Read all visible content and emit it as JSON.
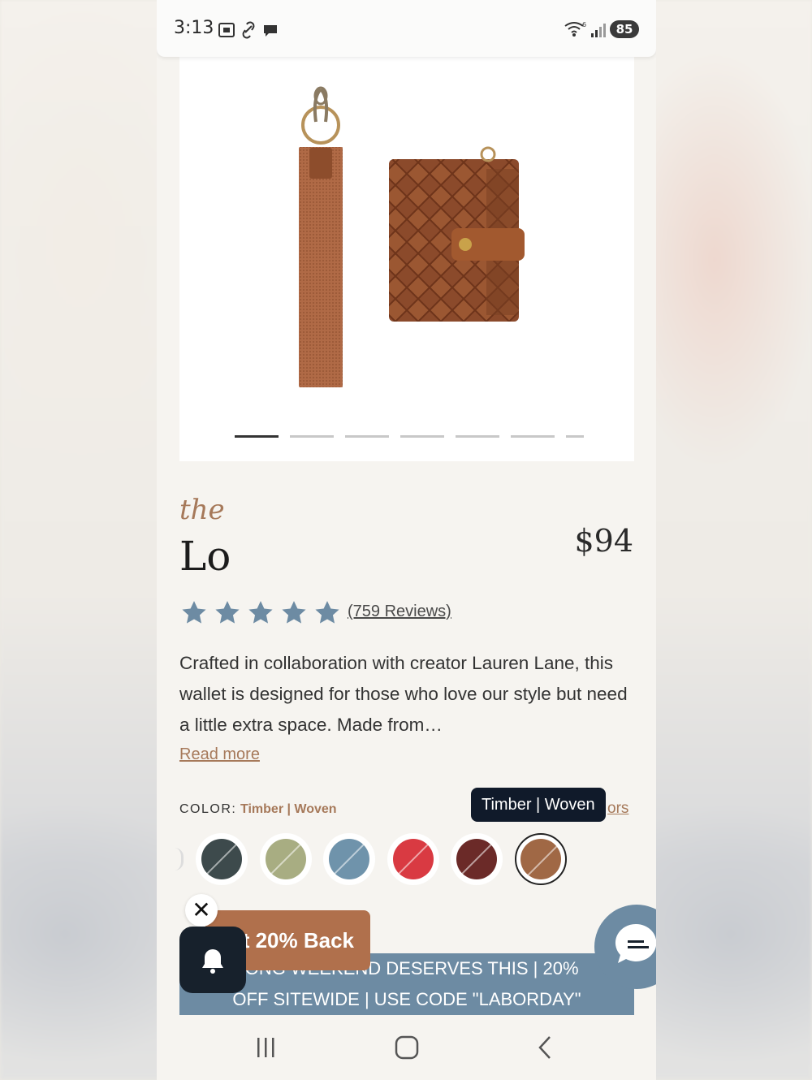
{
  "status_bar": {
    "time": "3:13",
    "battery": "85",
    "wifi_superscript": "6",
    "icons": [
      "screenshot-icon",
      "link-icon",
      "chat-bubble-icon",
      "wifi-icon",
      "signal-icon"
    ]
  },
  "product": {
    "prefix": "the",
    "name": "Lo",
    "price": "$94",
    "rating": 5,
    "reviews_label": "(759 Reviews)",
    "description": "Crafted in collaboration with creator Lauren Lane, this wallet is designed for those who love our style but need a little extra space. Made from…",
    "read_more_label": "Read more"
  },
  "carousel": {
    "count": 7,
    "active_index": 0
  },
  "color": {
    "label": "COLOR:",
    "value": "Timber | Woven",
    "tooltip": "Timber | Woven",
    "all_colors_link": "ors",
    "swatches": [
      {
        "name": "dark-slate",
        "color": "#3d4a4c"
      },
      {
        "name": "sage",
        "color": "#a8ad82"
      },
      {
        "name": "blue-denim",
        "color": "#6f93ab"
      },
      {
        "name": "red",
        "color": "#d93a42"
      },
      {
        "name": "burgundy",
        "color": "#6b2a28"
      },
      {
        "name": "timber-woven",
        "color": "#a06845",
        "selected": true
      }
    ]
  },
  "overlays": {
    "promo_pill": "Get 20% Back",
    "promo_banner_line1": "LONG WEEKEND DESERVES THIS | 20%",
    "promo_banner_line2": "OFF SITEWIDE | USE CODE \"LABORDAY\"",
    "close_symbol": "✕"
  },
  "colors": {
    "accent": "#a6795a",
    "banner": "#6d8ba3",
    "star": "#6d8ba3",
    "dark": "#17212c"
  }
}
